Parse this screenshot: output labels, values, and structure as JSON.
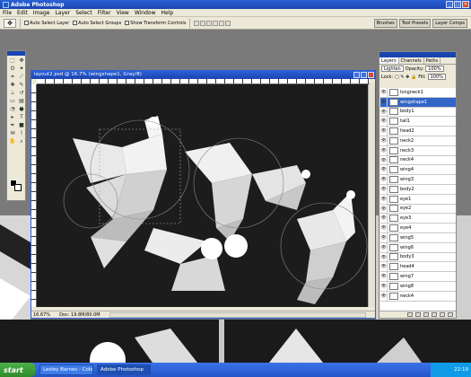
{
  "window": {
    "title": "Adobe Photoshop"
  },
  "menu": [
    "File",
    "Edit",
    "Image",
    "Layer",
    "Select",
    "Filter",
    "View",
    "Window",
    "Help"
  ],
  "options_bar": {
    "auto_select_layer": "Auto Select Layer",
    "auto_select_groups": "Auto Select Groups",
    "show_transform_controls": "Show Transform Controls"
  },
  "palette_wells": [
    "Brushes",
    "Tool Presets",
    "Layer Comps"
  ],
  "document": {
    "title": "layout2.psd @ 16.7% (wingshape1, Gray/8)",
    "zoom": "16.67%",
    "doc_info": "Doc: 19.8M/80.0M"
  },
  "layers_panel": {
    "tabs": [
      "Layers",
      "Channels",
      "Paths"
    ],
    "blend_mode": "Lighten",
    "opacity_label": "Opacity:",
    "opacity": "100%",
    "lock_label": "Lock:",
    "fill_label": "Fill:",
    "fill": "100%",
    "layers": [
      "longneck1",
      "wingshape1",
      "body1",
      "tail1",
      "head2",
      "neck2",
      "neck3",
      "neck4",
      "wing4",
      "wing3",
      "body2",
      "eye1",
      "eye2",
      "eye3",
      "eye4",
      "wing5",
      "wing6",
      "body3",
      "head4",
      "wing7",
      "wing8",
      "neck4"
    ],
    "selected_index": 1
  },
  "taskbar": {
    "start": "start",
    "tasks": [
      "Lesley Barnes - Colou...",
      "Adobe Photoshop"
    ],
    "clock": "22:19"
  }
}
